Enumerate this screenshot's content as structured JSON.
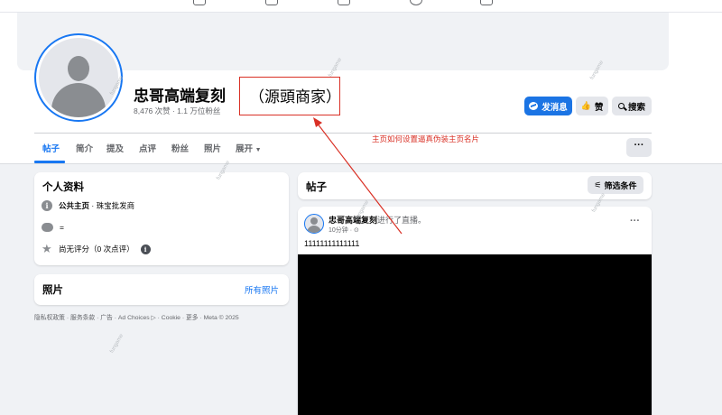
{
  "page": {
    "title": "忠哥高端复刻",
    "stats": "8,476 次赞 · 1.1 万位粉丝"
  },
  "annotation": {
    "box_text": "（源頭商家）",
    "note": "主页如何设置逼真伪装主页名片",
    "color": "#d93025"
  },
  "actions": {
    "message": "发消息",
    "like": "赞",
    "search": "搜索"
  },
  "tabs": [
    "帖子",
    "简介",
    "提及",
    "点评",
    "粉丝",
    "照片",
    "展开"
  ],
  "more_label": "···",
  "intro": {
    "title": "个人资料",
    "category_bold": "公共主页",
    "category_rest": " · 珠宝批发商",
    "contact": "=",
    "rating": "尚无评分（0 次点评）"
  },
  "photos": {
    "title": "照片",
    "link": "所有照片"
  },
  "footer": "隐私权政策 · 服务条款 · 广告 · Ad Choices ▷ · Cookie · 更多 · Meta © 2025",
  "posts_header": {
    "title": "帖子",
    "filter": "筛选条件"
  },
  "post": {
    "author": "忠哥高端复刻",
    "action": "进行了直播。",
    "time": "10分钟 · ⊙",
    "text": "11111111111111",
    "menu": "···"
  },
  "watermark": "fungame",
  "colors": {
    "accent": "#1877f2",
    "button_blue": "#1b74e4",
    "background": "#f0f2f5"
  }
}
